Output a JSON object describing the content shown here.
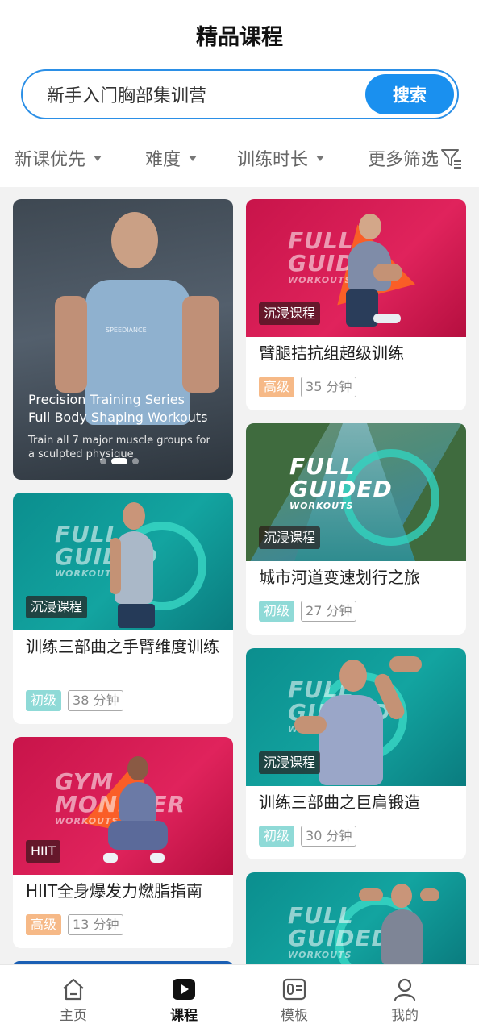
{
  "header": {
    "title": "精品课程"
  },
  "search": {
    "value": "新手入门胸部集训营",
    "button_label": "搜索"
  },
  "filters": [
    {
      "label": "新课优先"
    },
    {
      "label": "难度"
    },
    {
      "label": "训练时长"
    },
    {
      "label": "更多筛选"
    }
  ],
  "hero": {
    "line1": "Precision Training Series",
    "line2": "Full Body Shaping Workouts",
    "desc1": "Train all 7 major muscle groups for",
    "desc2": "a sculpted physique",
    "shirt_text": "SPEEDIANCE",
    "carousel_pages": 3,
    "carousel_active": 2
  },
  "brand_texts": {
    "full": "FULL",
    "guided": "GUIDED",
    "workouts": "WORKOUTS",
    "gym": "GYM",
    "monster": "MONSTER"
  },
  "courses": [
    {
      "badge": "沉浸课程",
      "title": "臂腿拮抗组超级训练",
      "level": "高级",
      "duration": "35 分钟"
    },
    {
      "badge": "沉浸课程",
      "title": "训练三部曲之手臂维度训练",
      "level": "初级",
      "duration": "38 分钟"
    },
    {
      "badge": "沉浸课程",
      "title": "城市河道变速划行之旅",
      "level": "初级",
      "duration": "27 分钟"
    },
    {
      "badge": "HIIT",
      "title": "HIIT全身爆发力燃脂指南",
      "level": "高级",
      "duration": "13 分钟"
    },
    {
      "badge": "沉浸课程",
      "title": "训练三部曲之巨肩锻造",
      "level": "初级",
      "duration": "30 分钟"
    }
  ],
  "tabbar": [
    {
      "label": "主页",
      "icon": "home-icon"
    },
    {
      "label": "课程",
      "icon": "play-icon"
    },
    {
      "label": "模板",
      "icon": "template-icon"
    },
    {
      "label": "我的",
      "icon": "profile-icon"
    }
  ],
  "colors": {
    "accent": "#1a90ef",
    "advanced_tag": "#f6b987",
    "beginner_tag": "#8fdad7",
    "pink_thumb": "#d81b54",
    "teal_thumb": "#0e9a97"
  }
}
